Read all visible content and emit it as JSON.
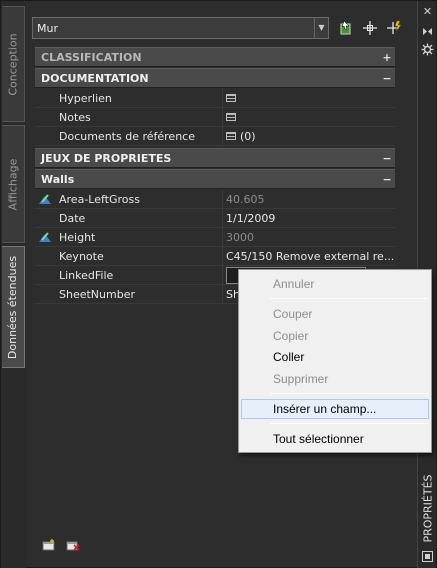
{
  "window": {
    "palette_label": "PROPRIÉTÉS",
    "close_glyph": "✕",
    "tabs": [
      {
        "label": "Conception"
      },
      {
        "label": "Affichage"
      },
      {
        "label": "Données étendues"
      }
    ]
  },
  "selector": {
    "value": "Mur",
    "arrow": "▼"
  },
  "toolbar": {
    "icons": [
      "select-objects-icon",
      "pick-point-icon",
      "quick-select-icon"
    ]
  },
  "sections": {
    "classification": {
      "label": "CLASSIFICATION",
      "toggle": "+"
    },
    "documentation": {
      "label": "DOCUMENTATION",
      "toggle": "−",
      "rows": [
        {
          "name": "Hyperlien",
          "value": ""
        },
        {
          "name": "Notes",
          "value": ""
        },
        {
          "name": "Documents de référence",
          "value": "(0)"
        }
      ]
    },
    "propsets": {
      "label": "JEUX DE PROPRIETES",
      "toggle": "−"
    },
    "walls": {
      "label": "Walls",
      "toggle": "−",
      "rows": [
        {
          "name": "Area-LeftGross",
          "value": "40.605"
        },
        {
          "name": "Date",
          "value": "1/1/2009"
        },
        {
          "name": "Height",
          "value": "3000"
        },
        {
          "name": "Keynote",
          "value": "C45/150 Remove external re..."
        },
        {
          "name": "LinkedFile",
          "value": ""
        },
        {
          "name": "SheetNumber",
          "value": "Sh"
        }
      ]
    }
  },
  "context_menu": {
    "items": [
      {
        "label": "Annuler",
        "enabled": false
      },
      {
        "label": "Couper",
        "enabled": false
      },
      {
        "label": "Copier",
        "enabled": false
      },
      {
        "label": "Coller",
        "enabled": true
      },
      {
        "label": "Supprimer",
        "enabled": false
      },
      {
        "label": "Insérer un champ...",
        "enabled": true,
        "highlighted": true
      },
      {
        "label": "Tout sélectionner",
        "enabled": true
      }
    ]
  },
  "colors": {
    "background": "#2d2d2d",
    "category_header": "#4a4a4a",
    "menu_bg": "#f0f0f0",
    "menu_highlight": "#e5f0fb",
    "disabled_text": "#8d8d8d"
  }
}
